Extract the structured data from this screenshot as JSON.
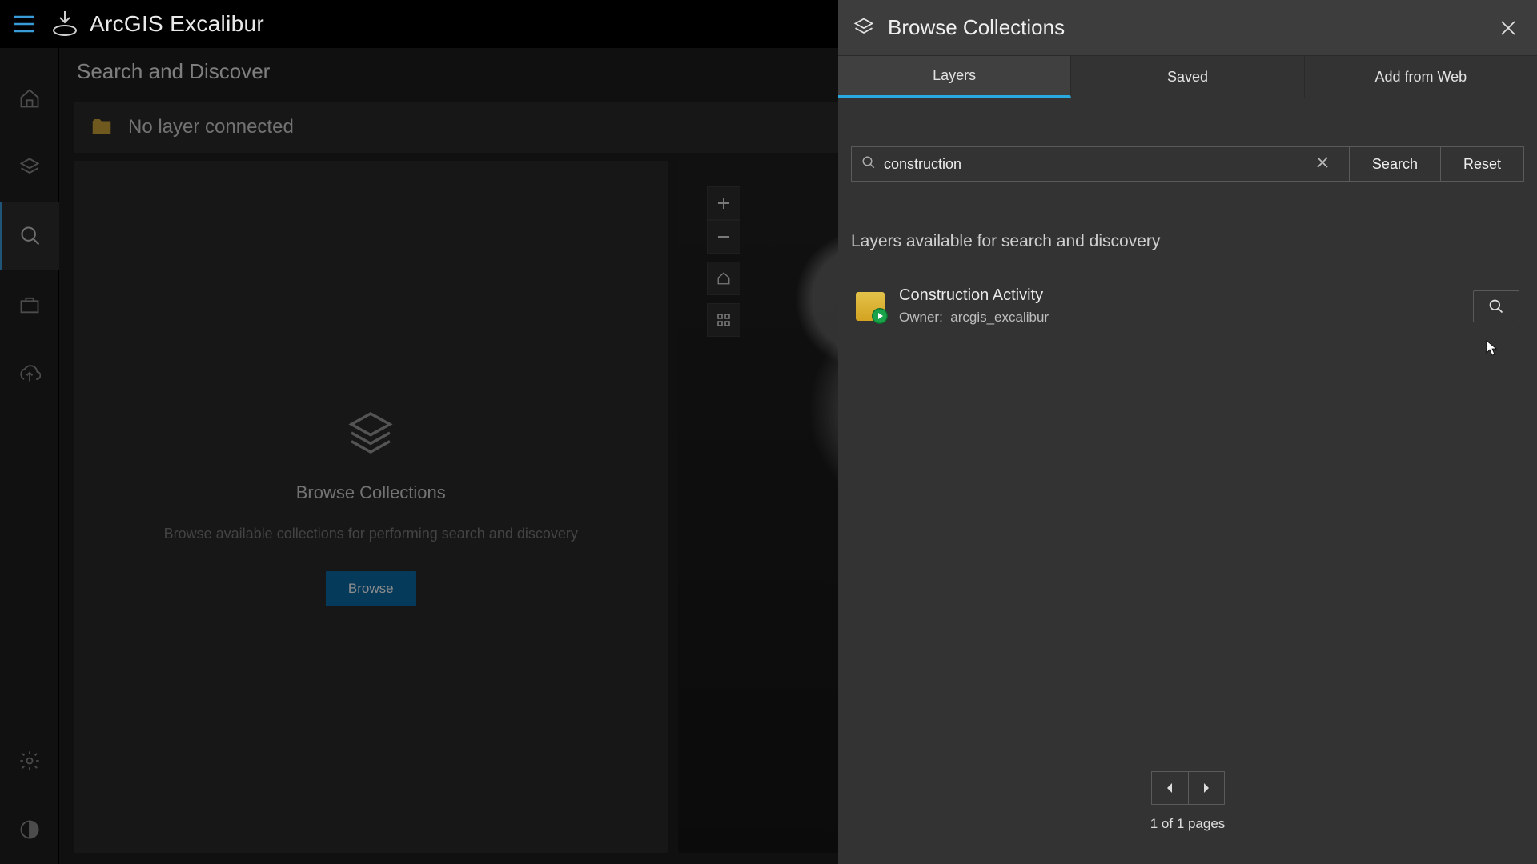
{
  "app": {
    "title": "ArcGIS Excalibur"
  },
  "page": {
    "title": "Search and Discover"
  },
  "layerBar": {
    "status": "No layer connected"
  },
  "card": {
    "title": "Browse Collections",
    "subtitle": "Browse available collections for performing search and discovery",
    "button": "Browse"
  },
  "panel": {
    "title": "Browse Collections",
    "tabs": {
      "layers": "Layers",
      "saved": "Saved",
      "addFromWeb": "Add from Web",
      "activeIndex": 0
    },
    "search": {
      "value": "construction",
      "searchBtn": "Search",
      "resetBtn": "Reset"
    },
    "results": {
      "heading": "Layers available for search and discovery",
      "items": [
        {
          "name": "Construction Activity",
          "ownerLabel": "Owner:",
          "owner": "arcgis_excalibur"
        }
      ]
    },
    "pager": {
      "text": "1 of 1 pages"
    }
  }
}
